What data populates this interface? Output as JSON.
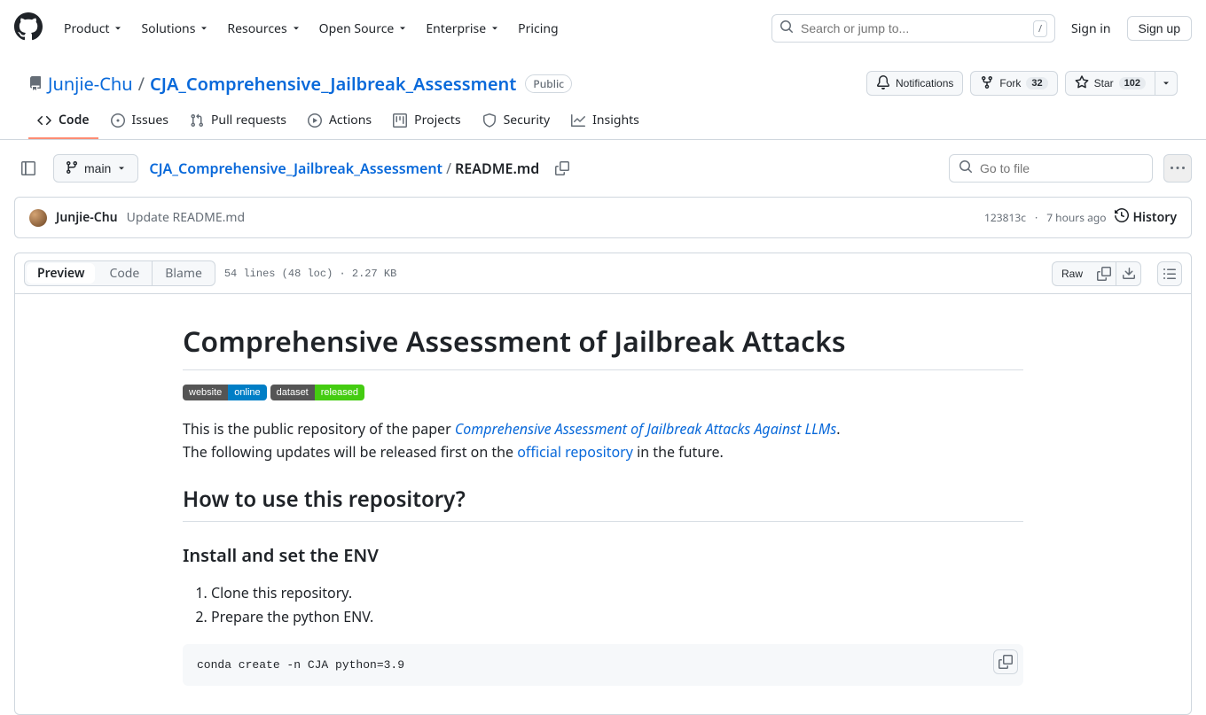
{
  "header": {
    "nav": [
      "Product",
      "Solutions",
      "Resources",
      "Open Source",
      "Enterprise",
      "Pricing"
    ],
    "search_placeholder": "Search or jump to...",
    "search_kbd": "/",
    "sign_in": "Sign in",
    "sign_up": "Sign up"
  },
  "repo": {
    "owner": "Junjie-Chu",
    "name": "CJA_Comprehensive_Jailbreak_Assessment",
    "visibility": "Public",
    "notifications": "Notifications",
    "fork": "Fork",
    "fork_count": "32",
    "star": "Star",
    "star_count": "102"
  },
  "tabs": {
    "code": "Code",
    "issues": "Issues",
    "pull_requests": "Pull requests",
    "actions": "Actions",
    "projects": "Projects",
    "security": "Security",
    "insights": "Insights"
  },
  "toolbar": {
    "branch": "main",
    "breadcrumb_root": "CJA_Comprehensive_Jailbreak_Assessment",
    "breadcrumb_file": "README.md",
    "go_to_file": "Go to file"
  },
  "commit": {
    "author": "Junjie-Chu",
    "message": "Update README.md",
    "sha": "123813c",
    "time": "7 hours ago",
    "history": "History"
  },
  "file_header": {
    "preview": "Preview",
    "code": "Code",
    "blame": "Blame",
    "meta": "54 lines (48 loc) · 2.27 KB",
    "raw": "Raw"
  },
  "readme": {
    "h1": "Comprehensive Assessment of Jailbreak Attacks",
    "badge1_left": "website",
    "badge1_right": "online",
    "badge2_left": "dataset",
    "badge2_right": "released",
    "p1_prefix": "This is the public repository of the paper ",
    "p1_link": "Comprehensive Assessment of Jailbreak Attacks Against LLMs",
    "p1_suffix": ".",
    "p2_prefix": "The following updates will be released first on the ",
    "p2_link": "official repository",
    "p2_suffix": " in the future.",
    "h2": "How to use this repository?",
    "h3": "Install and set the ENV",
    "step1": "Clone this repository.",
    "step2": "Prepare the python ENV.",
    "code": "conda create -n CJA python=3.9"
  }
}
